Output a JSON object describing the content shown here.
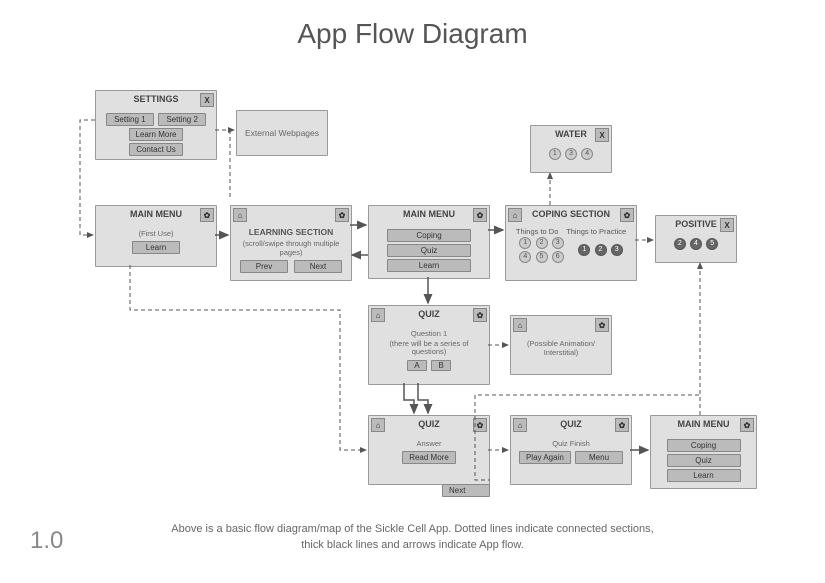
{
  "title": "App Flow Diagram",
  "version": "1.0",
  "caption_line1": "Above is a basic flow diagram/map of the Sickle Cell App. Dotted lines indicate connected sections,",
  "caption_line2": "thick black lines and arrows indicate App flow.",
  "cards": {
    "settings": {
      "title": "SETTINGS",
      "close": "X",
      "btn1": "Setting 1",
      "btn2": "Setting 2",
      "btn3": "Learn More",
      "btn4": "Contact Us"
    },
    "external": {
      "label": "External Webpages"
    },
    "mainmenu1": {
      "title": "MAIN MENU",
      "sub": "(First Use)",
      "btn": "Learn"
    },
    "learning": {
      "title": "LEARNING SECTION",
      "sub": "(scroll/swipe through multiple pages)",
      "prev": "Prev",
      "next": "Next"
    },
    "mainmenu2": {
      "title": "MAIN MENU",
      "btn1": "Coping",
      "btn2": "Quiz",
      "btn3": "Learn"
    },
    "coping": {
      "title": "COPING SECTION",
      "col1": "Things to Do",
      "col2": "Things to Practice",
      "nums1": [
        "1",
        "2",
        "3",
        "4",
        "5",
        "6"
      ],
      "nums2": [
        "1",
        "2",
        "3"
      ]
    },
    "water": {
      "title": "WATER",
      "close": "X",
      "nums": [
        "1",
        "3",
        "4"
      ]
    },
    "positive": {
      "title": "POSITIVE",
      "close": "X",
      "nums": [
        "2",
        "4",
        "5"
      ]
    },
    "quiz1": {
      "title": "QUIZ",
      "sub1": "Question 1",
      "sub2": "(there will be a series of questions)",
      "btnA": "A",
      "btnB": "B"
    },
    "interstitial": {
      "label": "(Possible Animation/ Interstitial)"
    },
    "quiz2": {
      "title": "QUIZ",
      "sub": "Answer",
      "btn": "Read More",
      "next": "Next"
    },
    "quiz3": {
      "title": "QUIZ",
      "sub": "Quiz Finish",
      "btn1": "Play Again",
      "btn2": "Menu"
    },
    "mainmenu3": {
      "title": "MAIN MENU",
      "btn1": "Coping",
      "btn2": "Quiz",
      "btn3": "Learn"
    }
  },
  "icons": {
    "home": "⌂",
    "gear": "✿"
  }
}
